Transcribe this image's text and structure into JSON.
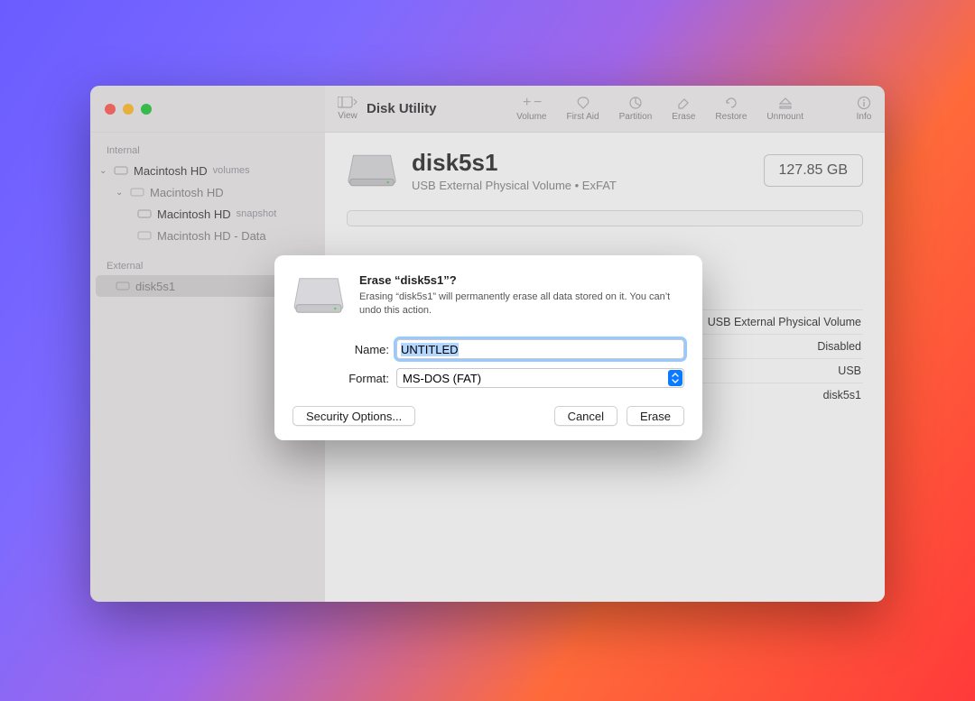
{
  "app_title": "Disk Utility",
  "toolbar": {
    "view": "View",
    "volume": "Volume",
    "first_aid": "First Aid",
    "partition": "Partition",
    "erase": "Erase",
    "restore": "Restore",
    "unmount": "Unmount",
    "info": "Info"
  },
  "sidebar": {
    "internal_header": "Internal",
    "external_header": "External",
    "items": [
      {
        "label": "Macintosh HD",
        "sub": "volumes"
      },
      {
        "label": "Macintosh HD"
      },
      {
        "label": "Macintosh HD",
        "sub": "snapshot"
      },
      {
        "label": "Macintosh HD - Data"
      },
      {
        "label": "disk5s1"
      }
    ]
  },
  "volume": {
    "name": "disk5s1",
    "subtitle": "USB External Physical Volume • ExFAT",
    "size": "127.85 GB"
  },
  "info": {
    "type_value": "USB External Physical Volume",
    "smart_value": "Disabled",
    "connection_value": "USB",
    "device_value": "disk5s1"
  },
  "modal": {
    "title": "Erase “disk5s1”?",
    "description": "Erasing “disk5s1” will permanently erase all data stored on it. You can’t undo this action.",
    "name_label": "Name:",
    "name_value": "UNTITLED",
    "format_label": "Format:",
    "format_value": "MS-DOS (FAT)",
    "security_btn": "Security Options...",
    "cancel_btn": "Cancel",
    "erase_btn": "Erase"
  }
}
